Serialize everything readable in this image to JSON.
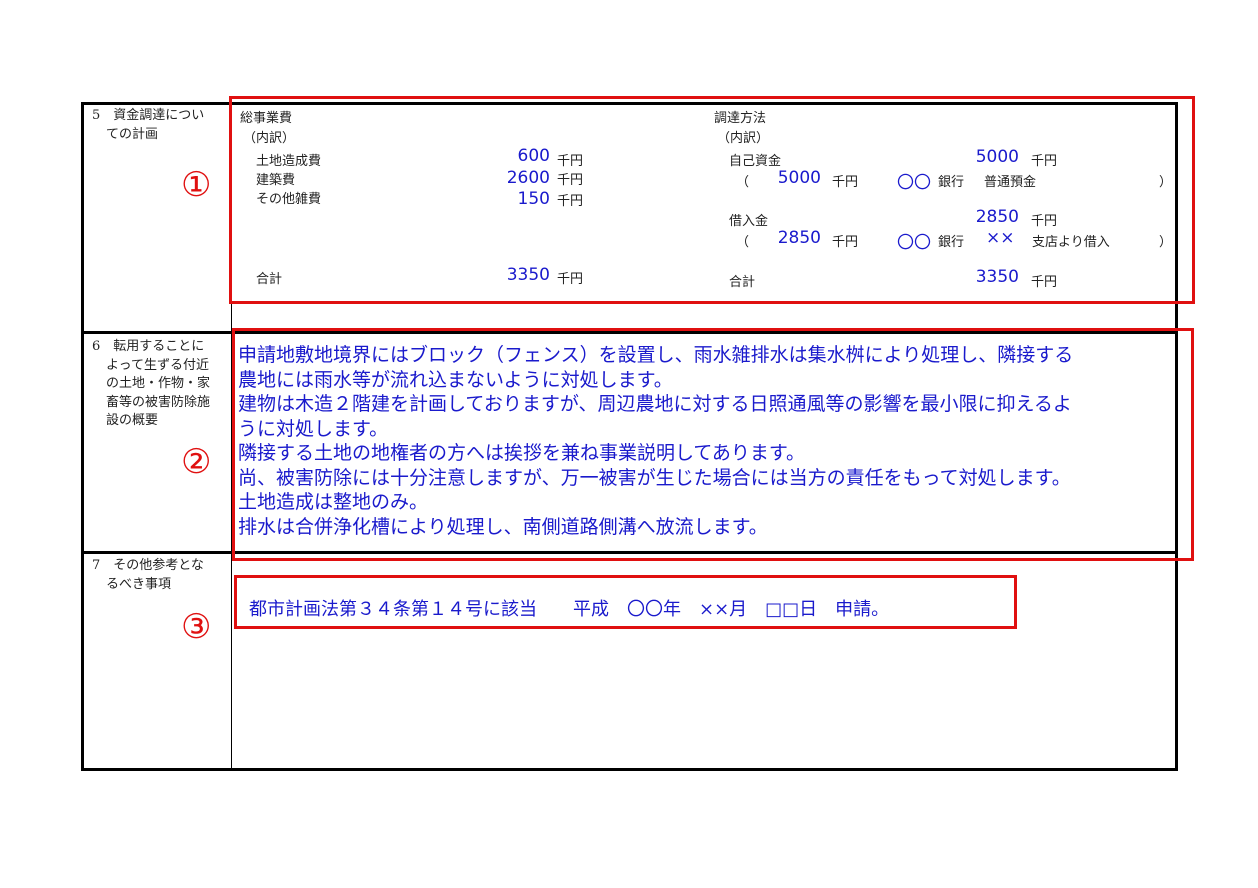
{
  "section5": {
    "label_lines": [
      "5　資金調達につい",
      "ての計画"
    ],
    "total_cost_heading": "総事業費",
    "breakdown_label": "（内訳）",
    "items": [
      {
        "label": "土地造成費",
        "amount": "600",
        "unit": "千円"
      },
      {
        "label": "建築費",
        "amount": "2600",
        "unit": "千円"
      },
      {
        "label": "その他雑費",
        "amount": "150",
        "unit": "千円"
      }
    ],
    "total_label": "合計",
    "total_amount": "3350",
    "total_unit": "千円",
    "funding_heading": "調達方法",
    "funding_breakdown_label": "（内訳）",
    "own_funds": {
      "label": "自己資金",
      "amount": "5000",
      "unit": "千円",
      "open_paren": "（",
      "detail_amount": "5000",
      "detail_unit": "千円",
      "bank": "〇〇",
      "bank_label": "銀行",
      "account": "普通預金",
      "close_paren": "）"
    },
    "loan": {
      "label": "借入金",
      "amount": "2850",
      "unit": "千円",
      "open_paren": "（",
      "detail_amount": "2850",
      "detail_unit": "千円",
      "bank": "〇〇",
      "bank_label": "銀行",
      "branch": "××",
      "branch_label": "支店より借入",
      "close_paren": "）"
    },
    "funding_total_label": "合計",
    "funding_total_amount": "3350",
    "funding_total_unit": "千円"
  },
  "section6": {
    "label_lines": [
      "6　転用することに",
      "よって生ずる付近",
      "の土地・作物・家",
      "畜等の被害防除施",
      "設の概要"
    ],
    "text_lines": [
      "申請地敷地境界にはブロック（フェンス）を設置し、雨水雑排水は集水桝により処理し、隣接する",
      "農地には雨水等が流れ込まないように対処します。",
      "建物は木造２階建を計画しておりますが、周辺農地に対する日照通風等の影響を最小限に抑えるよ",
      "うに対処します。",
      "隣接する土地の地権者の方へは挨拶を兼ね事業説明してあります。",
      "尚、被害防除には十分注意しますが、万一被害が生じた場合には当方の責任をもって対処します。",
      "土地造成は整地のみ。",
      "排水は合併浄化槽により処理し、南側道路側溝へ放流します。"
    ]
  },
  "section7": {
    "label_lines": [
      "7　その他参考とな",
      "るべき事項"
    ],
    "note": "都市計画法第３４条第１４号に該当　　平成　〇〇年　××月　□□日　申請。"
  },
  "markers": [
    "①",
    "②",
    "③"
  ],
  "colors": {
    "annotation_red": "#e01010",
    "filled_blue": "#1a1acc",
    "border": "#000000"
  }
}
